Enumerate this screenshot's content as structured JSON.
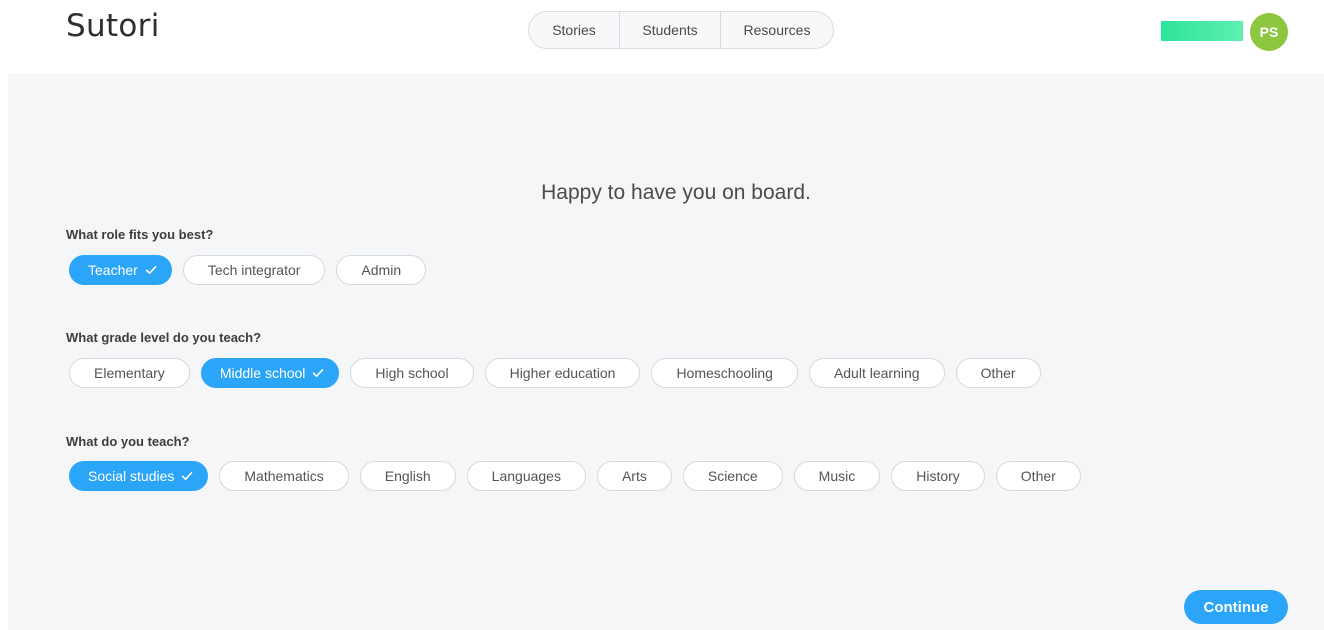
{
  "header": {
    "logo": "Sutori",
    "nav": [
      "Stories",
      "Students",
      "Resources"
    ],
    "avatar_initials": "PS"
  },
  "main": {
    "heading": "Happy to have you on board.",
    "questions": [
      {
        "label": "What role fits you best?",
        "options": [
          "Teacher",
          "Tech integrator",
          "Admin"
        ],
        "selected": "Teacher"
      },
      {
        "label": "What grade level do you teach?",
        "options": [
          "Elementary",
          "Middle school",
          "High school",
          "Higher education",
          "Homeschooling",
          "Adult learning",
          "Other"
        ],
        "selected": "Middle school"
      },
      {
        "label": "What do you teach?",
        "options": [
          "Social studies",
          "Mathematics",
          "English",
          "Languages",
          "Arts",
          "Science",
          "Music",
          "History",
          "Other"
        ],
        "selected": "Social studies"
      }
    ],
    "continue_label": "Continue"
  },
  "colors": {
    "accent": "#2ba5f7",
    "avatar_bg": "#8dc63f",
    "bar_green": "#3ee9a3",
    "panel_bg": "#f5f6f8"
  },
  "icons": {
    "selected_mark": "check-icon"
  }
}
